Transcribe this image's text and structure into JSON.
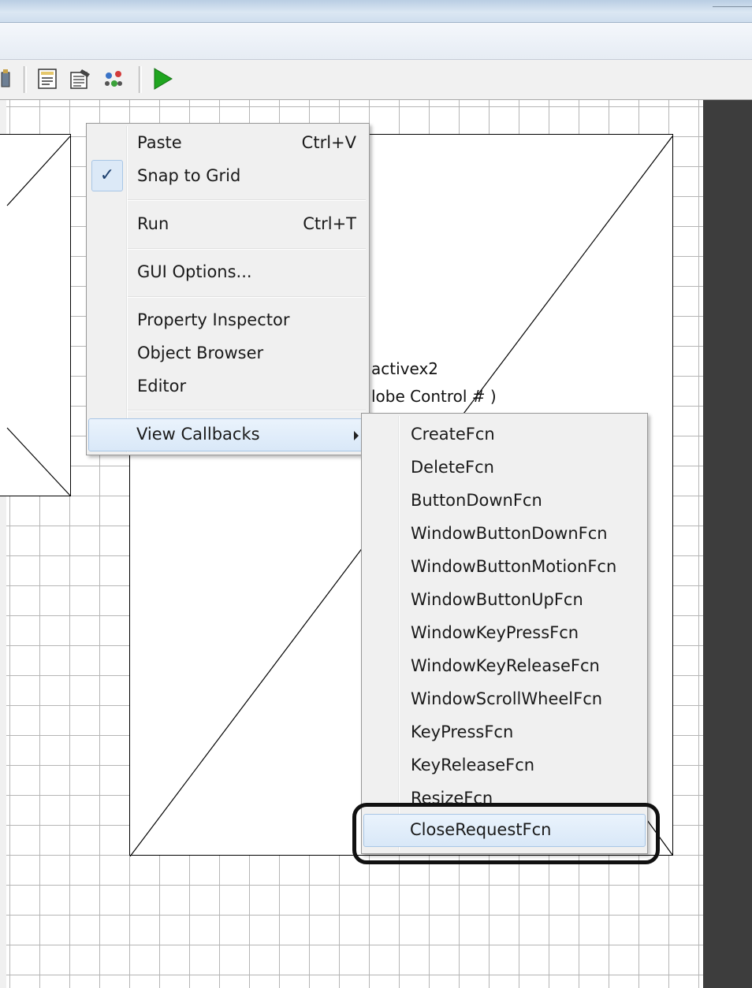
{
  "window": {
    "title": ""
  },
  "toolbar": {
    "icons": [
      "mfile-icon",
      "editor-icon",
      "property-inspector-icon",
      "object-browser-icon",
      "run-icon"
    ]
  },
  "axes": {
    "tag": "activex2",
    "control_text": "lobe Control # )"
  },
  "context_menu": {
    "items": [
      {
        "label": "Paste",
        "shortcut": "Ctrl+V"
      },
      {
        "label": "Snap to Grid",
        "checked": true
      },
      {
        "label": "Run",
        "shortcut": "Ctrl+T"
      },
      {
        "label": "GUI Options..."
      },
      {
        "label": "Property Inspector"
      },
      {
        "label": "Object Browser"
      },
      {
        "label": "Editor"
      },
      {
        "label": "View Callbacks",
        "has_submenu": true,
        "highlighted": true
      }
    ]
  },
  "callbacks_submenu": {
    "items": [
      {
        "label": "CreateFcn"
      },
      {
        "label": "DeleteFcn"
      },
      {
        "label": "ButtonDownFcn"
      },
      {
        "label": "WindowButtonDownFcn"
      },
      {
        "label": "WindowButtonMotionFcn"
      },
      {
        "label": "WindowButtonUpFcn"
      },
      {
        "label": "WindowKeyPressFcn"
      },
      {
        "label": "WindowKeyReleaseFcn"
      },
      {
        "label": "WindowScrollWheelFcn"
      },
      {
        "label": "KeyPressFcn"
      },
      {
        "label": "KeyReleaseFcn"
      },
      {
        "label": "ResizeFcn"
      },
      {
        "label": "CloseRequestFcn",
        "highlighted": true
      }
    ]
  },
  "colors": {
    "highlight": "#d9e8f8",
    "menu_bg": "#f0f0f0",
    "run_green": "#1fa51f",
    "grid": "#b5b5b5"
  }
}
